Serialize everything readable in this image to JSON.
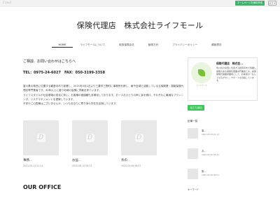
{
  "topbar": {
    "brand": "Crevd",
    "signup_label": "ホームページを無料作成",
    "login_label": "ログイン"
  },
  "header": {
    "site_title": "保険代理店　株式会社ライフモール",
    "nav": [
      {
        "label": "HOME"
      },
      {
        "label": "ライフモールについて"
      },
      {
        "label": "取扱保険会社"
      },
      {
        "label": "勧誘方針"
      },
      {
        "label": "プライバシーポリシー"
      },
      {
        "label": "顧客理念"
      }
    ]
  },
  "main": {
    "contact_heading": "ご相談、お問い合わせはこちらへ",
    "tel_line": "TEL：0975-24-6027　FAX：050-3199-3358",
    "paragraphs": [
      "香川県の県西に位置する観音寺市で創業し、2021年5月1日より三豊市三野町に事務所を移し、東予全域で活動しているる保険業・損害保険代理店専門業者です。40年以上に渡り地域の皆様に貢献出来ています。",
      "ライフスタイルや社会環境の変化に伴い、お客様の価値観も多様化しております。お一人おひとりの声に耳を傾け、それぞれに最適なプランニング、リスクマネジメントを提案しています。",
      "不安やご心配事はございませんか、いつもあなたに寄り添う存在を目指しています。"
    ],
    "cards": [
      {
        "title": "事務...",
        "date": "2021.05.24 01:14"
      },
      {
        "title": "お盆...",
        "date": "2020.08.10 09:22"
      },
      {
        "title": "条の...",
        "date": "2020.04.06 08:57"
      }
    ],
    "section_title": "OUR OFFICE"
  },
  "sidebar": {
    "profile_name": "保険代理店　株式会...",
    "profile_logo_text": "ライフモール",
    "profile_desc": "香川県の県西に位置する観音寺市で創業し保険のある保険代理業専門業者です。損保保険代理業者業者として、お客様の「なんでも気が付く」サポートを目指しています。",
    "line_button": "友だち追加",
    "recent_heading": "記事一覧",
    "posts": [
      {
        "title": "事...",
        "date": "2021.05.24 01:14"
      },
      {
        "title": "お...",
        "date": "2020.08.10 09:22"
      },
      {
        "title": "条...",
        "date": "2020.04.06 08:57"
      }
    ],
    "keyword_heading": "キーワード"
  }
}
